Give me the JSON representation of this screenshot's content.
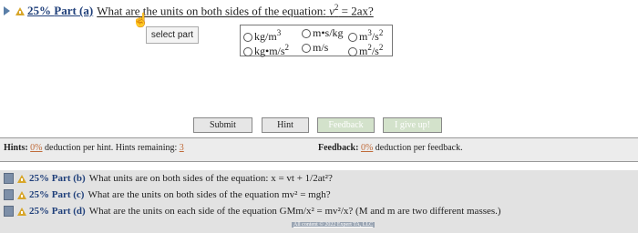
{
  "part_a": {
    "percent": "25%",
    "label": "Part (a)",
    "question": "What are the units on both sides of the equation:",
    "equation_lhs": "v",
    "equation_exp": "2",
    "equation_rhs": " = 2ax?"
  },
  "select_part_label": "select part",
  "choices": [
    {
      "base": "kg",
      "op": "/",
      "unit2": "m",
      "exp": "3",
      "label": "kg/m3"
    },
    {
      "text": "m•s/kg",
      "label": "m•s/kg"
    },
    {
      "base": "m",
      "exp": "3",
      "tail": "/s",
      "exp2": "2",
      "label": "m3/s2"
    },
    {
      "base": "kg•m/s",
      "exp": "2",
      "label": "kg•m/s2"
    },
    {
      "text": "m/s",
      "label": "m/s"
    },
    {
      "base": "m",
      "exp": "2",
      "tail": "/s",
      "exp2": "2",
      "label": "m2/s2"
    }
  ],
  "buttons": {
    "submit": "Submit",
    "hint": "Hint",
    "feedback": "Feedback",
    "give_up": "I give up!"
  },
  "hints": {
    "label": "Hints:",
    "percent": "0%",
    "text": "deduction per hint. Hints remaining:",
    "remaining": "3"
  },
  "feedback": {
    "label": "Feedback:",
    "percent": "0%",
    "text": "deduction per feedback."
  },
  "other_parts": [
    {
      "title": "25% Part (b)",
      "text": "What units are on both sides of the equation: x = vt + 1/2at²?"
    },
    {
      "title": "25% Part (c)",
      "text": "What are the units on both sides of the equation mv² = mgh?"
    },
    {
      "title": "25% Part (d)",
      "text": "What are the units on each side of the equation GMm/x² = mv²/x? (M and m are two different masses.)"
    }
  ],
  "footer": "All content © 2022 Expert TA, LLC",
  "colors": {
    "title_blue": "#1f3f7a",
    "link_orange": "#c06b3a",
    "disabled_green": "#d3e2cb",
    "info_bar": "#ececec"
  }
}
